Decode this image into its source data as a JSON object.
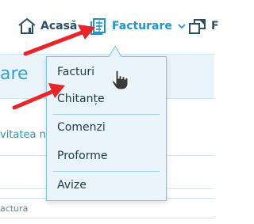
{
  "nav": {
    "home_label": "Acasă",
    "invoicing_label": "Facturare",
    "partial_label": "F",
    "icons": {
      "home": "house-icon",
      "invoicing": "invoice-icon",
      "chevron": "chevron-down-icon",
      "partial": "window-icon"
    }
  },
  "page": {
    "title": "are",
    "activity_link": "vitatea n",
    "grid_label": "actura"
  },
  "dropdown": {
    "items": [
      {
        "label": "Facturi"
      },
      {
        "label": "Chitanțe"
      },
      {
        "label": "Comenzi"
      },
      {
        "label": "Proforme"
      },
      {
        "label": "Avize"
      }
    ]
  },
  "colors": {
    "accent": "#1f95c9",
    "dropdown_bg": "#e9f4fb",
    "dropdown_border": "#7fc3e0",
    "annotation_arrow": "#e8262a"
  }
}
